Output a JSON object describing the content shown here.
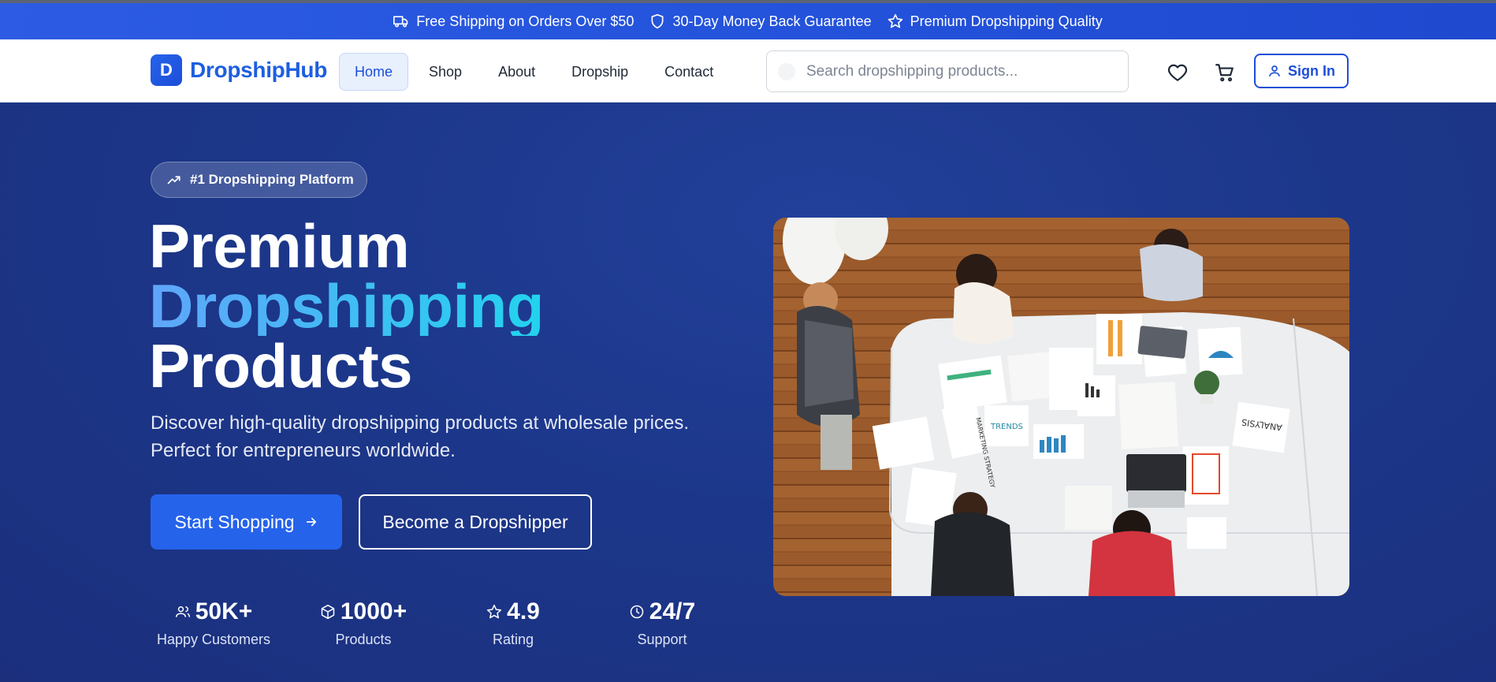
{
  "promo_bar": {
    "items": [
      {
        "icon": "truck-icon",
        "text": "Free Shipping on Orders Over $50"
      },
      {
        "icon": "shield-icon",
        "text": "30-Day Money Back Guarantee"
      },
      {
        "icon": "star-icon",
        "text": "Premium Dropshipping Quality"
      }
    ]
  },
  "header": {
    "logo_letter": "D",
    "brand": "DropshipHub",
    "nav": [
      {
        "label": "Home",
        "active": true
      },
      {
        "label": "Shop"
      },
      {
        "label": "About"
      },
      {
        "label": "Dropship"
      },
      {
        "label": "Contact"
      }
    ],
    "search_placeholder": "Search dropshipping products...",
    "sign_in": "Sign In"
  },
  "hero": {
    "badge": "#1 Dropshipping Platform",
    "title_line1": "Premium",
    "title_line2": "Dropshipping",
    "title_line3": "Products",
    "lead_line1": "Discover high-quality dropshipping products at wholesale prices.",
    "lead_line2": "Perfect for entrepreneurs worldwide.",
    "cta_primary": "Start Shopping",
    "cta_secondary": "Become a Dropshipper",
    "stats": [
      {
        "icon": "users-icon",
        "value": "50K+",
        "label": "Happy Customers"
      },
      {
        "icon": "box-icon",
        "value": "1000+",
        "label": "Products"
      },
      {
        "icon": "star-icon",
        "value": "4.9",
        "label": "Rating"
      },
      {
        "icon": "clock-icon",
        "value": "24/7",
        "label": "Support"
      }
    ]
  },
  "photo_labels": {
    "trends": "TRENDS",
    "analysis": "ANALYSIS",
    "marketing": "MARKETING STRATEGY"
  },
  "colors": {
    "brand": "#1d5fe0",
    "hero_bg": "#1e3a8a",
    "accent_start": "#60a5fa",
    "accent_end": "#22d3ee"
  }
}
